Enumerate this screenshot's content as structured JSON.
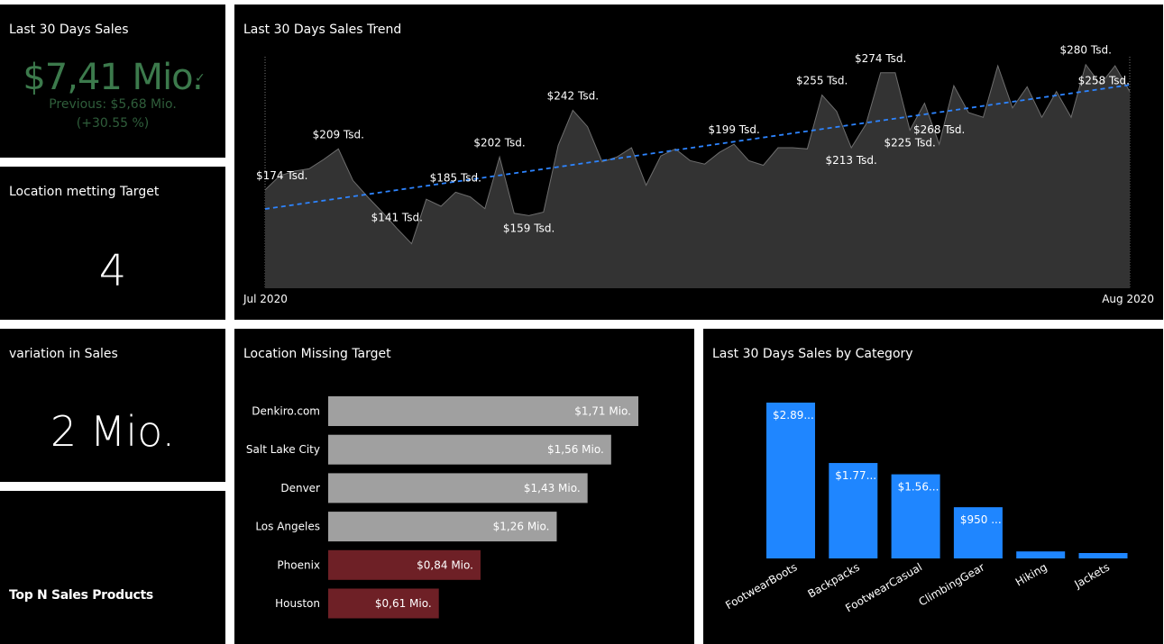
{
  "kpi_sales": {
    "title": "Last 30 Days Sales",
    "value": "$7,41 Mio.",
    "check": "✓",
    "previous": "Previous: $5,68 Mio.",
    "change": "(+30.55 %)"
  },
  "kpi_locations": {
    "title": "Location metting Target",
    "value": "4"
  },
  "kpi_variation": {
    "title": "variation in Sales",
    "value": "2 Mio."
  },
  "top_n": {
    "title": "Top N Sales Products"
  },
  "colors": {
    "tile_bg": "#000000",
    "area_fill": "#333333",
    "area_line": "#6e6e6e",
    "trend_line": "#2d84ff",
    "bar_gray": "#a0a0a0",
    "bar_red": "#6e2026",
    "bar_blue": "#1f86ff",
    "kpi_green": "#3c7a4c"
  },
  "chart_data": [
    {
      "type": "area",
      "title": "Last 30 Days Sales Trend",
      "x_start_label": "Jul 2020",
      "x_end_label": "Aug 2020",
      "trendline": true,
      "values": [
        174,
        186,
        190,
        192,
        200,
        209,
        182,
        168,
        155,
        141,
        128,
        166,
        160,
        172,
        168,
        158,
        202,
        154,
        152,
        155,
        212,
        242,
        228,
        198,
        202,
        210,
        178,
        203,
        209,
        199,
        196,
        206,
        213,
        199,
        195,
        210,
        210,
        209,
        255,
        241,
        210,
        230,
        274,
        274,
        225,
        248,
        213,
        263,
        240,
        236,
        280,
        244,
        262,
        236,
        258,
        236,
        281,
        264,
        280,
        258
      ],
      "point_labels": [
        {
          "i": 0,
          "text": "$174 Tsd."
        },
        {
          "i": 5,
          "text": "$209 Tsd."
        },
        {
          "i": 9,
          "text": "$141 Tsd."
        },
        {
          "i": 13,
          "text": "$185 Tsd."
        },
        {
          "i": 16,
          "text": "$202 Tsd."
        },
        {
          "i": 18,
          "text": "$159 Tsd."
        },
        {
          "i": 21,
          "text": "$242 Tsd."
        },
        {
          "i": 32,
          "text": "$199 Tsd."
        },
        {
          "i": 38,
          "text": "$255 Tsd."
        },
        {
          "i": 40,
          "text": "$213 Tsd."
        },
        {
          "i": 42,
          "text": "$274 Tsd."
        },
        {
          "i": 44,
          "text": "$225 Tsd."
        },
        {
          "i": 46,
          "text": "$268 Tsd."
        },
        {
          "i": 56,
          "text": "$280 Tsd."
        },
        {
          "i": 59,
          "text": "$258 Tsd."
        }
      ]
    },
    {
      "type": "bar",
      "orientation": "horizontal",
      "title": "Location Missing Target",
      "categories": [
        "Denkiro.com",
        "Salt Lake City",
        "Denver",
        "Los Angeles",
        "Phoenix",
        "Houston"
      ],
      "values": [
        1.71,
        1.56,
        1.43,
        1.26,
        0.84,
        0.61
      ],
      "labels": [
        "$1,71 Mio.",
        "$1,56 Mio.",
        "$1,43 Mio.",
        "$1,26 Mio.",
        "$0,84 Mio.",
        "$0,61 Mio."
      ],
      "highlight": [
        false,
        false,
        false,
        false,
        true,
        true
      ],
      "xlim": [
        0,
        1.71
      ]
    },
    {
      "type": "bar",
      "orientation": "vertical",
      "title": "Last 30 Days Sales by Category",
      "categories": [
        "FootwearBoots",
        "Backpacks",
        "FootwearCasual",
        "ClimbingGear",
        "Hiking",
        "Jackets"
      ],
      "values": [
        2.89,
        1.77,
        1.56,
        0.95,
        0.13,
        0.1
      ],
      "labels": [
        "$2.89...",
        "$1.77...",
        "$1.56...",
        "$950 ...",
        "",
        ""
      ],
      "ylim": [
        0,
        2.89
      ]
    }
  ]
}
